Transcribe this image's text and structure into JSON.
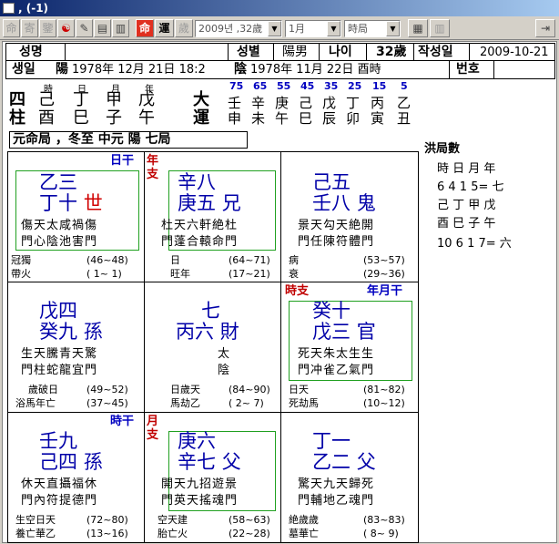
{
  "window": {
    "title": ", (-1)"
  },
  "toolbar": {
    "buttons": [
      "命",
      "寄",
      "鑒",
      "☯",
      "✎",
      "▤",
      "▥",
      "命",
      "運",
      "歲"
    ],
    "year_select": "2009년 ,32歲",
    "month_select": "1月",
    "hour_select": "時局"
  },
  "info": {
    "name_label": "성명",
    "gender_label": "성별",
    "gender_value": "陽男",
    "age_label": "나이",
    "age_value": "32歲",
    "made_label": "작성일",
    "made_value": "2009-10-21",
    "birth_label": "생일",
    "solar_mark": "陽",
    "solar_date": "1978年  12月  21日  18:2",
    "lunar_mark": "陰",
    "lunar_date": "1978年  11月  22日  酉時",
    "number_label": "번호"
  },
  "saju": {
    "side_top": "四",
    "side_bottom": "柱",
    "headers": [
      "時",
      "日",
      "月",
      "年"
    ],
    "stems": [
      "己",
      "丁",
      "甲",
      "戊"
    ],
    "branches": [
      "酉",
      "巳",
      "子",
      "午"
    ]
  },
  "daeun": {
    "label_top": "大",
    "label_bottom": "運",
    "ages": [
      "75",
      "65",
      "55",
      "45",
      "35",
      "25",
      "15",
      "5"
    ],
    "stems": [
      "壬",
      "辛",
      "庚",
      "己",
      "戊",
      "丁",
      "丙",
      "乙"
    ],
    "branches": [
      "申",
      "未",
      "午",
      "巳",
      "辰",
      "卯",
      "寅",
      "丑"
    ]
  },
  "bureau": "元命局  ，冬至 中元 陽 七局",
  "palaces": [
    {
      "tag1": "日干",
      "tag2": "年支",
      "l1": "乙三",
      "l2a": "丁十",
      "l2b": "世",
      "s1": "傷天太咸禍傷",
      "s2": "門心陰池害門",
      "f1a": "冠獨",
      "f1b": "(46~48)",
      "f2a": "帶火",
      "f2b": "( 1~ 1)"
    },
    {
      "l1": "辛八",
      "l2a": "庚五",
      "l2b": "兄",
      "s1": "杜天六軒絶杜",
      "s2": "門蓬合轅命門",
      "f1a": "日",
      "f1b": "(64~71)",
      "f2a": "旺年",
      "f2b": "(17~21)"
    },
    {
      "l1": "己五",
      "l2a": "壬八",
      "l2b": "鬼",
      "s1": "景天勾天絶開",
      "s2": "門任陳符體門",
      "f1a": "病",
      "f1b": "(53~57)",
      "f2a": "衰",
      "f2b": "(29~36)"
    },
    {
      "l1": "戊四",
      "l2a": "癸九",
      "l2b": "孫",
      "s1": "生天騰青天驚",
      "s2": "門柱蛇龍宜門",
      "f1a": "歲破日",
      "f1b": "(49~52)",
      "f2a": "浴馬年亡",
      "f2b": "(37~45)"
    },
    {
      "l1": "七",
      "l2a": "丙六",
      "l2b": "財",
      "s1": "太",
      "s2": "陰",
      "f1a": "日歲天",
      "f1b": "(84~90)",
      "f2a": "馬劫乙",
      "f2b": "( 2~ 7)"
    },
    {
      "tag1": "時支",
      "tag2": "年月干",
      "l1": "癸十",
      "l2a": "戊三",
      "l2b": "官",
      "s1": "死天朱太生生",
      "s2": "門冲雀乙氣門",
      "f1a": "日天",
      "f1b": "(81~82)",
      "f2a": "死劫馬",
      "f2b": "(10~12)"
    },
    {
      "tag1": "時干",
      "tag2": "月支",
      "l1": "壬九",
      "l2a": "己四",
      "l2b": "孫",
      "s1": "休天直攝福休",
      "s2": "門內符提德門",
      "f1a": "生空日天",
      "f1b": "(72~80)",
      "f2a": "養亡華乙",
      "f2b": "(13~16)"
    },
    {
      "l1": "庚六",
      "l2a": "辛七",
      "l2b": "父",
      "s1": "開天九招遊景",
      "s2": "門英天搖魂門",
      "f1a": "空天建",
      "f1b": "(58~63)",
      "f2a": "胎亡火",
      "f2b": "(22~28)"
    },
    {
      "l1": "丁一",
      "l2a": "乙二",
      "l2b": "父",
      "s1": "驚天九天歸死",
      "s2": "門輔地乙魂門",
      "f1a": "絶歲歲",
      "f1b": "(83~83)",
      "f2a": "墓華亡",
      "f2b": "( 8~ 9)"
    }
  ],
  "side": {
    "title": "洪局數",
    "row1": "時  日  月  年",
    "row2": " 6   4   1   5= 七",
    "row3": " 己  丁  甲  戊",
    "row4": " 酉  巳  子  午",
    "row5": " 10   6   1   7= 六"
  }
}
